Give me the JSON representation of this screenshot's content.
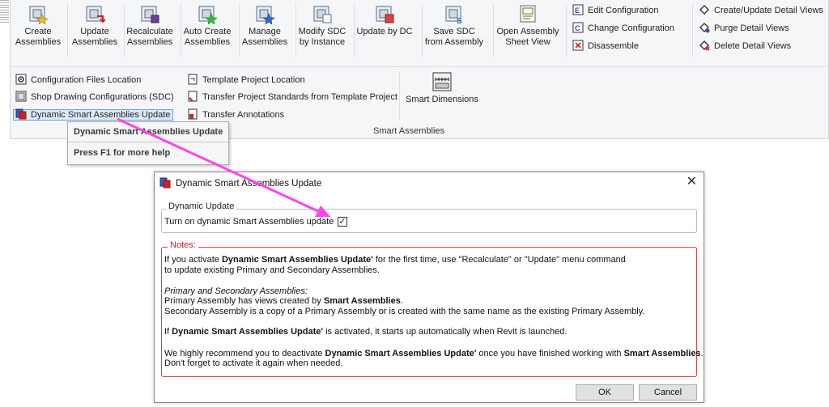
{
  "ribbon": {
    "big_buttons": [
      {
        "line1": "Create",
        "line2": "Assemblies"
      },
      {
        "line1": "Update",
        "line2": "Assemblies"
      },
      {
        "line1": "Recalculate",
        "line2": "Assemblies"
      },
      {
        "line1": "Auto Create",
        "line2": "Assemblies"
      },
      {
        "line1": "Manage",
        "line2": "Assemblies"
      },
      {
        "line1": "Modify SDC",
        "line2": "by Instance"
      },
      {
        "line1": "Update by DC",
        "line2": ""
      },
      {
        "line1": "Save SDC",
        "line2": "from Assembly"
      },
      {
        "line1": "Open Assembly",
        "line2": "Sheet View"
      }
    ],
    "config_items": [
      "Edit Configuration",
      "Change Configuration",
      "Disassemble"
    ],
    "detail_items": [
      "Create/Update Detail Views",
      "Purge Detail Views",
      "Delete Detail Views"
    ],
    "lower_col1": [
      "Configuration Files Location",
      "Shop Drawing Configurations (SDC)",
      "Dynamic Smart Assemblies Update"
    ],
    "lower_col2": [
      "Template Project Location",
      "Transfer Project Standards from Template Project",
      "Transfer Annotations"
    ],
    "smart_dimensions": "Smart Dimensions",
    "panel_label": "Smart Assemblies"
  },
  "tooltip": {
    "title": "Dynamic Smart Assemblies Update",
    "help": "Press F1 for more help"
  },
  "dialog": {
    "title": "Dynamic Smart Assemblies Update",
    "close": "✕",
    "group_label": "Dynamic Update",
    "checkbox_label": "Turn on dynamic Smart Assemblies update",
    "checkbox_mark": "✓",
    "notes_label": "Notes:",
    "n1a": "If you activate ",
    "n1b": "Dynamic Smart Assemblies Update'",
    "n1c": " for the first time, use \"Recalculate\" or \"Update\" menu command",
    "n2": "to update existing Primary and Secondary Assemblies.",
    "n3": "Primary and Secondary Assemblies:",
    "n4a": "Primary Assembly has views created by ",
    "n4b": "Smart Assemblies",
    ".": ".",
    "n5": "Secondary Assembly is a copy of a Primary Assembly or is created with the same name as the existing Primary Assembly.",
    "n6a": "If ",
    "n6b": "Dynamic Smart Assemblies Update'",
    "n6c": " is activated, it starts up automatically when Revit is launched.",
    "n7a": "We highly recommend you to deactivate ",
    "n7b": "Dynamic Smart Assemblies Update'",
    "n7c": " once you have finished working with ",
    "n7d": "Smart Assemblies",
    "n8": "Don't forget to activate it again when needed.",
    "ok": "OK",
    "cancel": "Cancel"
  },
  "colors": {
    "accent": "#ff44ee",
    "notes_border": "#e04040",
    "highlight": "#dbeaf9"
  }
}
